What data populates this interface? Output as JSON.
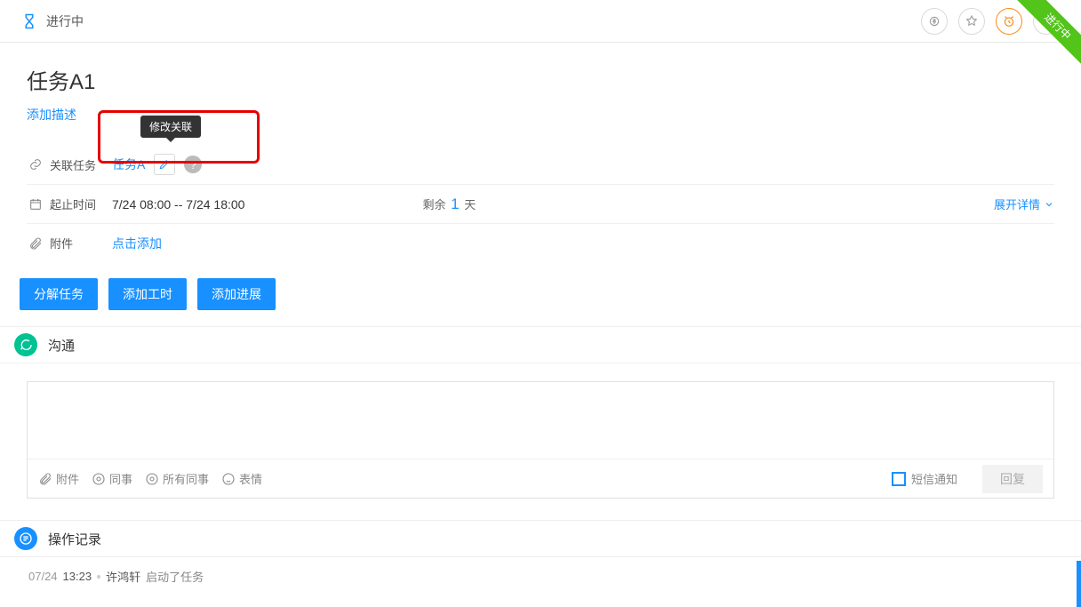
{
  "topbar": {
    "status": "进行中"
  },
  "corner_ribbon": "进行中",
  "task": {
    "title": "任务A1",
    "add_description": "添加描述"
  },
  "rows": {
    "related": {
      "label": "关联任务",
      "value": "任务A",
      "tooltip": "修改关联"
    },
    "time": {
      "label": "起止时间",
      "value": "7/24 08:00 -- 7/24 18:00",
      "remaining_prefix": "剩余",
      "remaining_num": "1",
      "remaining_suffix": "天",
      "expand": "展开详情"
    },
    "attachment": {
      "label": "附件",
      "add": "点击添加"
    }
  },
  "actions": {
    "decompose": "分解任务",
    "add_hours": "添加工时",
    "add_progress": "添加进展"
  },
  "communication": {
    "title": "沟通",
    "toolbar": {
      "attachment": "附件",
      "colleague": "同事",
      "all_colleagues": "所有同事",
      "emoji": "表情"
    },
    "sms_notify": "短信通知",
    "reply": "回复"
  },
  "log": {
    "title": "操作记录",
    "date": "07/24",
    "time": "13:23",
    "user": "许鸿轩",
    "action": "启动了任务"
  }
}
